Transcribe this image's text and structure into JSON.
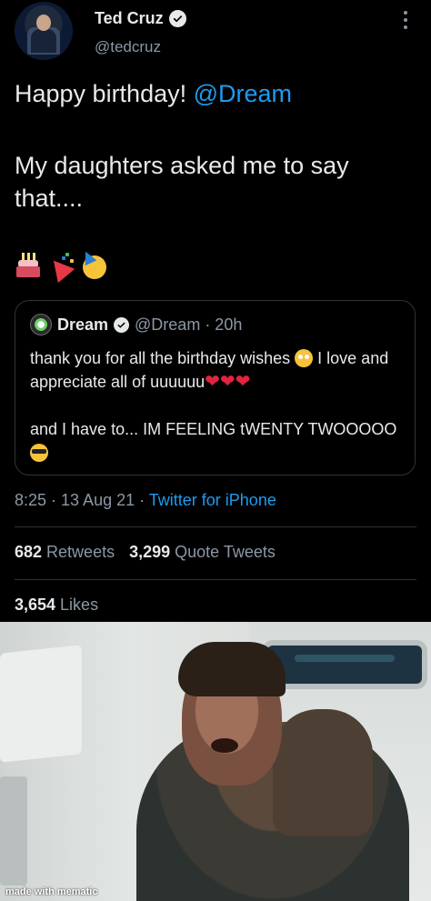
{
  "tweet": {
    "author": {
      "display_name": "Ted Cruz",
      "handle": "@tedcruz",
      "verified_icon": "verified-badge-icon"
    },
    "text_line1": "Happy birthday! ",
    "text_mention": "@Dream",
    "text_line2": "My daughters asked me to say that....",
    "emojis": [
      "birthday-cake-emoji",
      "party-popper-emoji",
      "partying-face-emoji"
    ],
    "quoted": {
      "display_name": "Dream",
      "meta": "@Dream · 20h",
      "para1": "thank you for all the birthday wishes ",
      "para1b": " I love and appreciate all of uuuuuu",
      "para2": "and I have to... IM FEELING tWENTY TWOOOOO ",
      "hearts": "❤❤❤"
    },
    "timestamp": "8:25 · 13 Aug 21 · ",
    "source": "Twitter for iPhone",
    "retweets_count": "682",
    "retweets_label": " Retweets",
    "quotes_count": "3,299",
    "quotes_label": " Quote Tweets",
    "likes_count": "3,654",
    "likes_label": " Likes"
  },
  "meme": {
    "watermark": "made with mematic"
  },
  "colors": {
    "background": "#000000",
    "text": "#e7e9ea",
    "secondary": "#8b98a5",
    "accent": "#1d9bf0"
  }
}
